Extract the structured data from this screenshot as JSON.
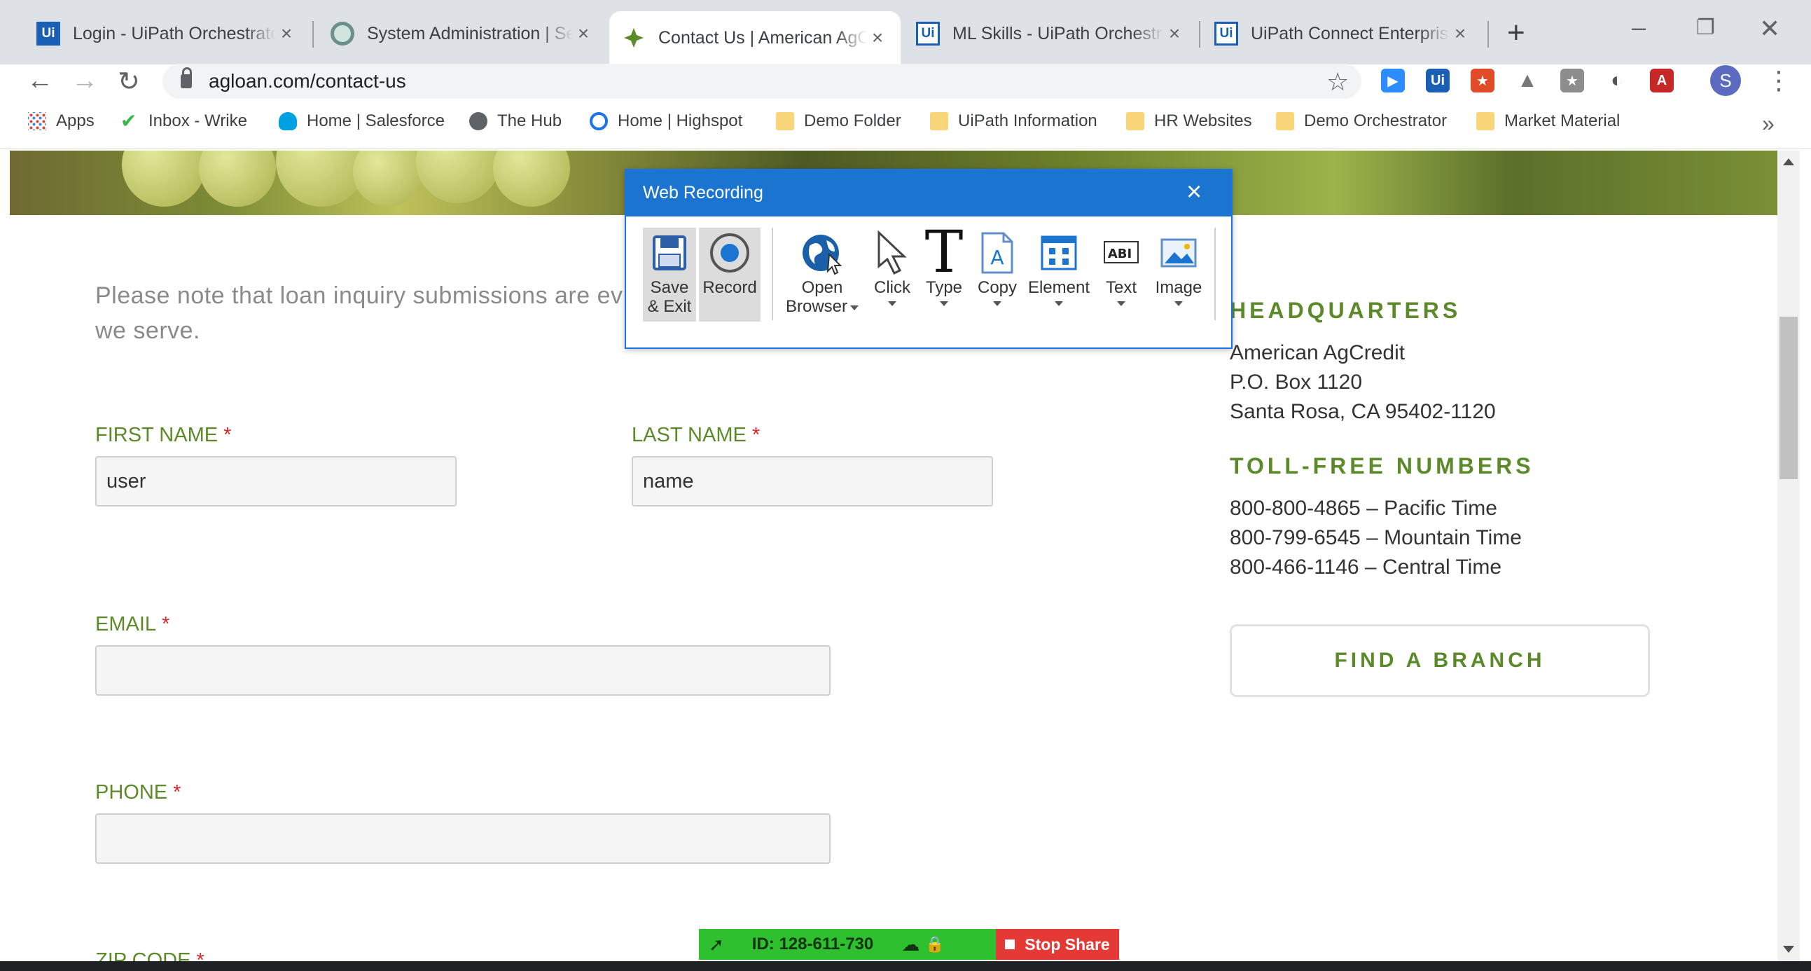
{
  "browser": {
    "tabs": [
      {
        "title": "Login - UiPath Orchestrator",
        "icon": "uipath-icon"
      },
      {
        "title": "System Administration | Ser",
        "icon": "servicenow-icon"
      },
      {
        "title": "Contact Us | American AgCr",
        "icon": "agcredit-leaf-icon",
        "active": true
      },
      {
        "title": "ML Skills - UiPath Orchestra",
        "icon": "uipath-icon"
      },
      {
        "title": "UiPath Connect Enterprise",
        "icon": "uipath-icon"
      }
    ],
    "url": "agloan.com/contact-us",
    "profile_initial": "S",
    "bookmarks": [
      "Apps",
      "Inbox - Wrike",
      "Home | Salesforce",
      "The Hub",
      "Home | Highspot",
      "Demo Folder",
      "UiPath Information",
      "HR Websites",
      "Demo Orchestrator",
      "Market Material"
    ],
    "bookmarks_overflow": "»"
  },
  "page": {
    "notice": "Please note that loan inquiry submissions are ev we serve.",
    "notice_line1": "Please note that loan inquiry submissions are ev",
    "notice_line2": "we serve.",
    "form": {
      "first_name_label": "FIRST NAME",
      "first_name_value": "user",
      "last_name_label": "LAST NAME",
      "last_name_value": "name",
      "email_label": "EMAIL",
      "email_value": "",
      "phone_label": "PHONE",
      "phone_value": "",
      "zip_label": "ZIP CODE",
      "required_marker": "*"
    },
    "sidebar": {
      "hq_title": "HEADQUARTERS",
      "hq_lines": [
        "American AgCredit",
        "P.O. Box 1120",
        "Santa Rosa, CA 95402-1120"
      ],
      "tollfree_title": "TOLL-FREE NUMBERS",
      "tollfree_lines": [
        "800-800-4865 – Pacific Time",
        "800-799-6545 – Mountain Time",
        "800-466-1146 – Central Time"
      ],
      "find_branch": "FIND A BRANCH"
    }
  },
  "recorder": {
    "title": "Web Recording",
    "buttons": [
      {
        "label": "Save & Exit",
        "line1": "Save",
        "line2": "& Exit",
        "icon": "floppy-disk-icon"
      },
      {
        "label": "Record",
        "icon": "record-icon"
      },
      {
        "label": "Open Browser",
        "line1": "Open",
        "line2": "Browser",
        "icon": "globe-icon"
      },
      {
        "label": "Click",
        "icon": "pointer-icon"
      },
      {
        "label": "Type",
        "icon": "type-t-icon"
      },
      {
        "label": "Copy",
        "icon": "copy-document-icon"
      },
      {
        "label": "Element",
        "icon": "element-grid-icon"
      },
      {
        "label": "Text",
        "icon": "text-abi-icon"
      },
      {
        "label": "Image",
        "icon": "image-icon"
      }
    ]
  },
  "zoom": {
    "meeting_id": "ID: 128-611-730",
    "stop_share": "Stop Share"
  },
  "colors": {
    "brand_green": "#5c8a2a",
    "required_red": "#d9262b",
    "recorder_blue": "#1b75d0",
    "zoom_green": "#2ec02e",
    "zoom_red": "#e53935"
  }
}
